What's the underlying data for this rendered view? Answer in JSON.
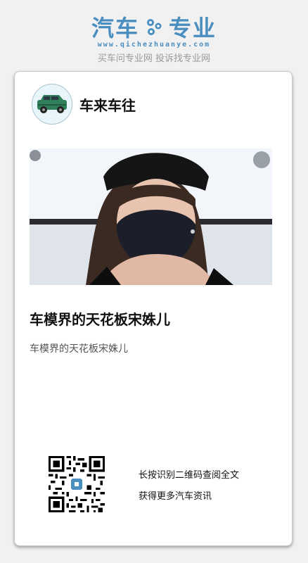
{
  "header": {
    "logo_left": "汽车",
    "logo_right": "专业",
    "logo_url": "www.qichezhuanye.com",
    "slogan": "买车问专业网 投诉找专业网",
    "brand_color": "#4a8ec0"
  },
  "card": {
    "author_name": "车来车往",
    "title": "车模界的天花板宋姝儿",
    "summary": "车模界的天花板宋姝儿",
    "qr_text_line1": "长按识别二维码查阅全文",
    "qr_text_line2": "获得更多汽车资讯"
  },
  "icons": {
    "logo_gear": "gear-icon",
    "avatar": "car-icon",
    "qr": "qr-code"
  }
}
